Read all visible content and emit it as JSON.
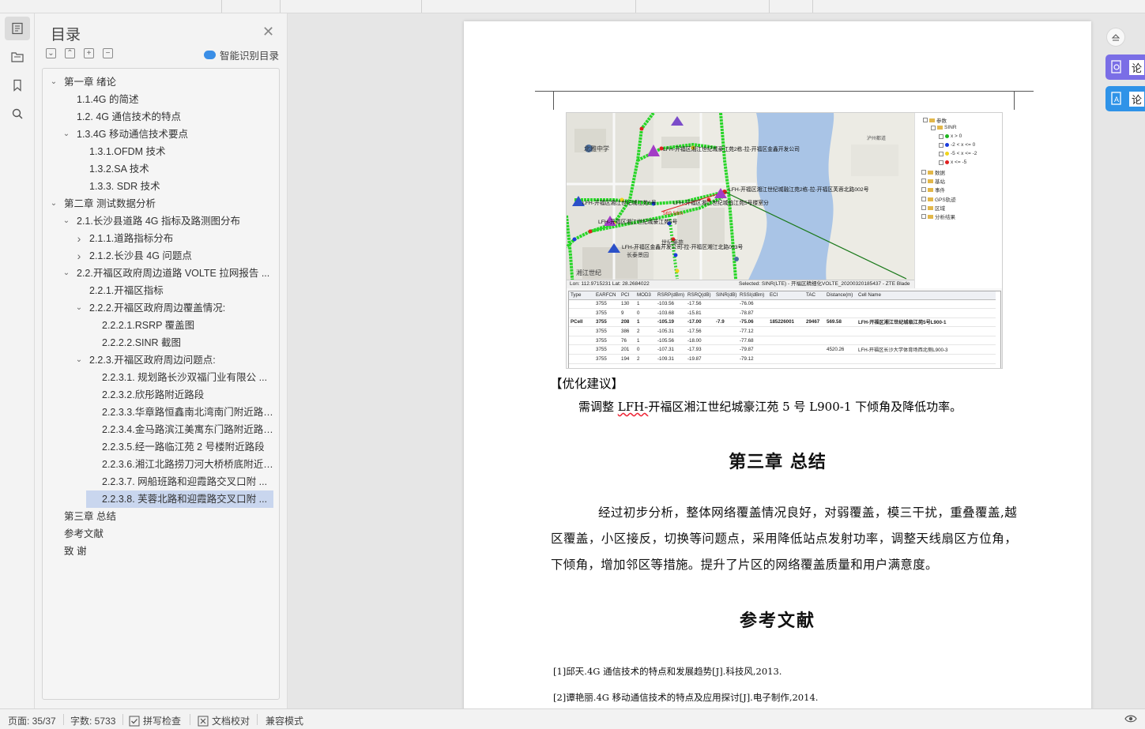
{
  "toc": {
    "title": "目录",
    "smart_label": "智能识别目录",
    "items": [
      {
        "label": "第一章  绪论",
        "level": 0,
        "arrow": "down"
      },
      {
        "label": "1.1.4G 的简述",
        "level": 1,
        "arrow": ""
      },
      {
        "label": "1.2.  4G 通信技术的特点",
        "level": 1,
        "arrow": ""
      },
      {
        "label": "1.3.4G 移动通信技术要点",
        "level": 1,
        "arrow": "down"
      },
      {
        "label": "1.3.1.OFDM 技术",
        "level": 2,
        "arrow": ""
      },
      {
        "label": "1.3.2.SA 技术",
        "level": 2,
        "arrow": ""
      },
      {
        "label": "1.3.3.  SDR 技术",
        "level": 2,
        "arrow": ""
      },
      {
        "label": "第二章  测试数据分析",
        "level": 0,
        "arrow": "down"
      },
      {
        "label": "2.1.长沙县道路 4G 指标及路测图分布",
        "level": 1,
        "arrow": "down"
      },
      {
        "label": "2.1.1.道路指标分布",
        "level": 2,
        "arrow": "right"
      },
      {
        "label": "2.1.2.长沙县 4G 问题点",
        "level": 2,
        "arrow": "right"
      },
      {
        "label": "2.2.开福区政府周边道路 VOLTE 拉网报告 ...",
        "level": 1,
        "arrow": "down"
      },
      {
        "label": "2.2.1.开福区指标",
        "level": 2,
        "arrow": ""
      },
      {
        "label": "2.2.2.开福区政府周边覆盖情况:",
        "level": 2,
        "arrow": "down"
      },
      {
        "label": "2.2.2.1.RSRP 覆盖图",
        "level": 3,
        "arrow": ""
      },
      {
        "label": "2.2.2.2.SINR 截图",
        "level": 3,
        "arrow": ""
      },
      {
        "label": "2.2.3.开福区政府周边问题点:",
        "level": 2,
        "arrow": "down"
      },
      {
        "label": "2.2.3.1.  规划路长沙双福门业有限公 ...",
        "level": 3,
        "arrow": ""
      },
      {
        "label": "2.2.3.2.欣彤路附近路段",
        "level": 3,
        "arrow": ""
      },
      {
        "label": "2.2.3.3.华章路恒鑫南北湾南门附近路 ...",
        "level": 3,
        "arrow": ""
      },
      {
        "label": "2.2.3.4.金马路滨江美寓东门路附近路 ...",
        "level": 3,
        "arrow": ""
      },
      {
        "label": "2.2.3.5.经一路临江苑 2 号楼附近路段",
        "level": 3,
        "arrow": ""
      },
      {
        "label": "2.2.3.6.湘江北路捞刀河大桥桥底附近 ...",
        "level": 3,
        "arrow": ""
      },
      {
        "label": "2.2.3.7.  网船班路和迎霞路交叉口附 ...",
        "level": 3,
        "arrow": ""
      },
      {
        "label": "2.2.3.8.  芙蓉北路和迎霞路交叉口附 ...",
        "level": 3,
        "arrow": "",
        "selected": true
      },
      {
        "label": "第三章  总结",
        "level": 0,
        "arrow": ""
      },
      {
        "label": "参考文献",
        "level": 0,
        "arrow": ""
      },
      {
        "label": "致    谢",
        "level": 0,
        "arrow": ""
      }
    ]
  },
  "screenshot": {
    "map_labels": [
      "北雅中学",
      "LFH-开福区湘江世纪城豪江苑2栋-拉-开福区金鑫开发公司",
      "LFH-开福区湘江世纪城融江苑2栋-拉-开福区芙蓉北路002号",
      "LFH-开福区湘江世纪城江苑6号",
      "LFH-开福区湘江世纪城豪江苑5号",
      "LFH-开福区湘江世纪城临江苑5号楼室分",
      "LFH-开福区金鑫开发公司-拉-开福区湘江北路093号",
      "569.58m",
      "世纪豪苑",
      "长泰景园",
      "湘江世纪",
      "泸州都道"
    ],
    "status_text": "Lon:  112.9715231   Lat:  28.2684022",
    "selected_text": "Selected: SINR(LTE) - 开福区精细化VOLTE_20200320185437 - ZTE Blade",
    "legend": [
      {
        "label": "参数"
      },
      {
        "label": "SINR"
      },
      {
        "label": "x > 0",
        "color": "#1fb51f"
      },
      {
        "label": "-2 < x <= 0",
        "color": "#1a3cdc"
      },
      {
        "label": "-5 < x <= -2",
        "color": "#f0d41a"
      },
      {
        "label": "x <= -5",
        "color": "#e02020"
      },
      {
        "label": "数据"
      },
      {
        "label": "基站"
      },
      {
        "label": "事件"
      },
      {
        "label": "GPS轨迹"
      },
      {
        "label": "区域"
      },
      {
        "label": "分析结果"
      }
    ],
    "table_headers": [
      "Type",
      "EARFCN",
      "PCI",
      "MOD3",
      "RSRP(dBm)",
      "RSRQ(dB)",
      "SINR(dB)",
      "RSSI(dBm)",
      "ECI",
      "TAC",
      "Distance(m)",
      "Cell Name"
    ],
    "table_rows": [
      [
        "",
        "3755",
        "130",
        "1",
        "-103.56",
        "-17.56",
        "",
        "-76.06",
        "",
        "",
        "",
        ""
      ],
      [
        "",
        "3755",
        "9",
        "0",
        "-103.68",
        "-15.81",
        "",
        "-78.87",
        "",
        "",
        "",
        ""
      ],
      [
        "PCell",
        "3755",
        "208",
        "1",
        "-105.19",
        "-17.00",
        "-7.9",
        "-75.06",
        "185226001",
        "29467",
        "569.58",
        "LFH-开福区湘江世纪城临江苑5号L900-1"
      ],
      [
        "",
        "3755",
        "386",
        "2",
        "-105.31",
        "-17.56",
        "",
        "-77.12",
        "",
        "",
        "",
        ""
      ],
      [
        "",
        "3755",
        "76",
        "1",
        "-105.56",
        "-18.00",
        "",
        "-77.68",
        "",
        "",
        "",
        ""
      ],
      [
        "",
        "3755",
        "201",
        "0",
        "-107.31",
        "-17.93",
        "",
        "-79.87",
        "",
        "",
        "4520.26",
        "LFH-开福区长沙大学体育场西北侧L900-3"
      ],
      [
        "",
        "3755",
        "194",
        "2",
        "-109.31",
        "-19.87",
        "",
        "-79.12",
        "",
        "",
        "",
        ""
      ]
    ]
  },
  "doc": {
    "opt_title": "【优化建议】",
    "opt_body_prefix": "需调整 ",
    "opt_body_squiggly": "LFH-",
    "opt_body_suffix": "开福区湘江世纪城豪江苑 5 号 L900-1 下倾角及降低功率。",
    "chapter3": "第三章  总结",
    "paragraph": "经过初步分析，整体网络覆盖情况良好，对弱覆盖，模三干扰，重叠覆盖,越区覆盖，小区接反，切换等问题点，采用降低站点发射功率，调整天线扇区方位角，下倾角，增加邻区等措施。提升了片区的网络覆盖质量和用户满意度。",
    "refs_title": "参考文献",
    "ref1": "[1]邱天.4G 通信技术的特点和发展趋势[J].科技风,2013.",
    "ref2": "[2]谭艳丽.4G 移动通信技术的特点及应用探讨[J].电子制作,2014."
  },
  "rightbar": {
    "card1": "论",
    "card2": "论"
  },
  "status": {
    "page": "页面: 35/37",
    "words": "字数: 5733",
    "spell": "拼写检查",
    "proof": "文档校对",
    "compat": "兼容模式"
  }
}
